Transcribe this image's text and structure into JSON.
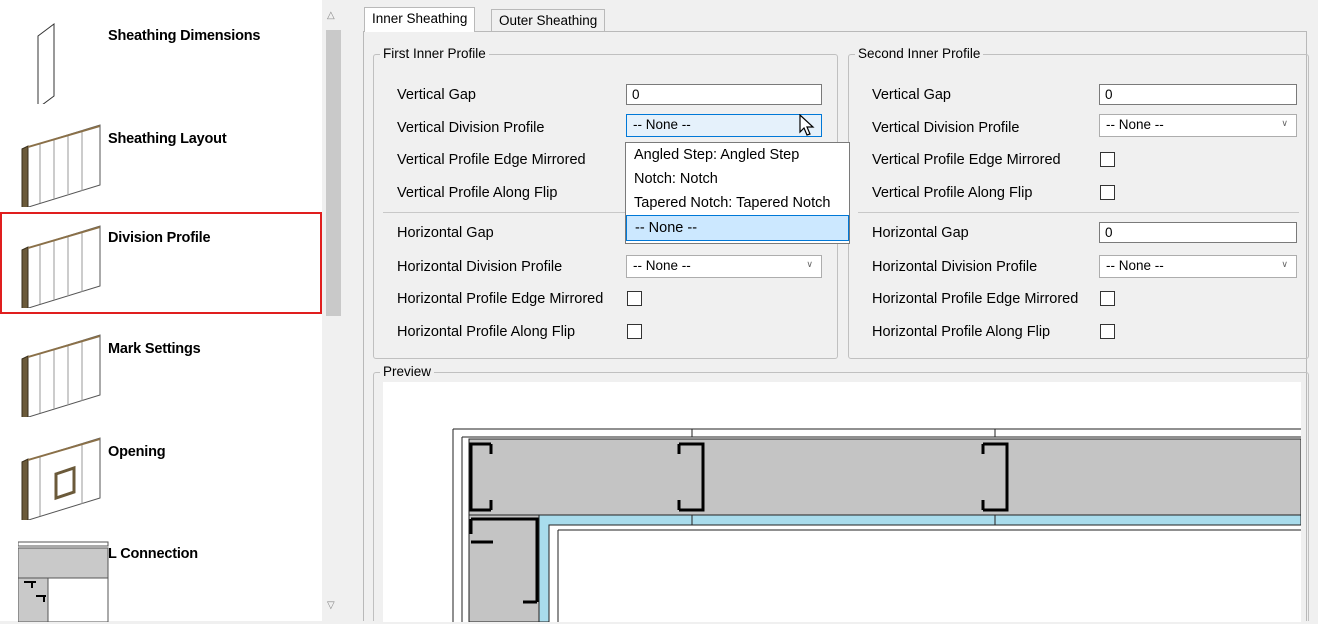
{
  "sidebar": {
    "items": [
      {
        "label": "Sheathing Dimensions"
      },
      {
        "label": "Sheathing Layout"
      },
      {
        "label": "Division Profile"
      },
      {
        "label": "Mark Settings"
      },
      {
        "label": "Opening"
      },
      {
        "label": "L Connection"
      }
    ],
    "selected_index": 2,
    "scroll_up_icon": "chevron-up-icon",
    "scroll_down_icon": "chevron-down-icon"
  },
  "tabs": [
    {
      "label": "Inner Sheathing"
    },
    {
      "label": "Outer Sheathing"
    }
  ],
  "first_profile": {
    "title": "First Inner Profile",
    "vertical_gap_label": "Vertical Gap",
    "vertical_gap_value": "0",
    "vertical_division_label": "Vertical Division Profile",
    "vertical_division_value": "-- None --",
    "vertical_edge_mirrored_label": "Vertical Profile Edge Mirrored",
    "vertical_along_flip_label": "Vertical Profile Along Flip",
    "horizontal_gap_label": "Horizontal Gap",
    "horizontal_division_label": "Horizontal Division Profile",
    "horizontal_division_value": "-- None --",
    "horizontal_edge_mirrored_label": "Horizontal Profile Edge Mirrored",
    "horizontal_along_flip_label": "Horizontal Profile Along Flip"
  },
  "second_profile": {
    "title": "Second Inner Profile",
    "vertical_gap_label": "Vertical Gap",
    "vertical_gap_value": "0",
    "vertical_division_label": "Vertical Division Profile",
    "vertical_division_value": "-- None --",
    "vertical_edge_mirrored_label": "Vertical Profile Edge Mirrored",
    "vertical_along_flip_label": "Vertical Profile Along Flip",
    "horizontal_gap_label": "Horizontal Gap",
    "horizontal_gap_value": "0",
    "horizontal_division_label": "Horizontal Division Profile",
    "horizontal_division_value": "-- None --",
    "horizontal_edge_mirrored_label": "Horizontal Profile Edge Mirrored",
    "horizontal_along_flip_label": "Horizontal Profile Along Flip"
  },
  "dropdown_options": [
    {
      "label": "Angled Step: Angled Step"
    },
    {
      "label": "Notch: Notch"
    },
    {
      "label": "Tapered Notch: Tapered Notch"
    },
    {
      "label": "-- None --"
    }
  ],
  "preview": {
    "title": "Preview"
  },
  "colors": {
    "selection_border": "#e01e1e",
    "focus_blue": "#0078d7",
    "highlight": "#cce8ff",
    "sheathing_blue": "#a9dcec",
    "stud_gray": "#c4c4c4"
  }
}
